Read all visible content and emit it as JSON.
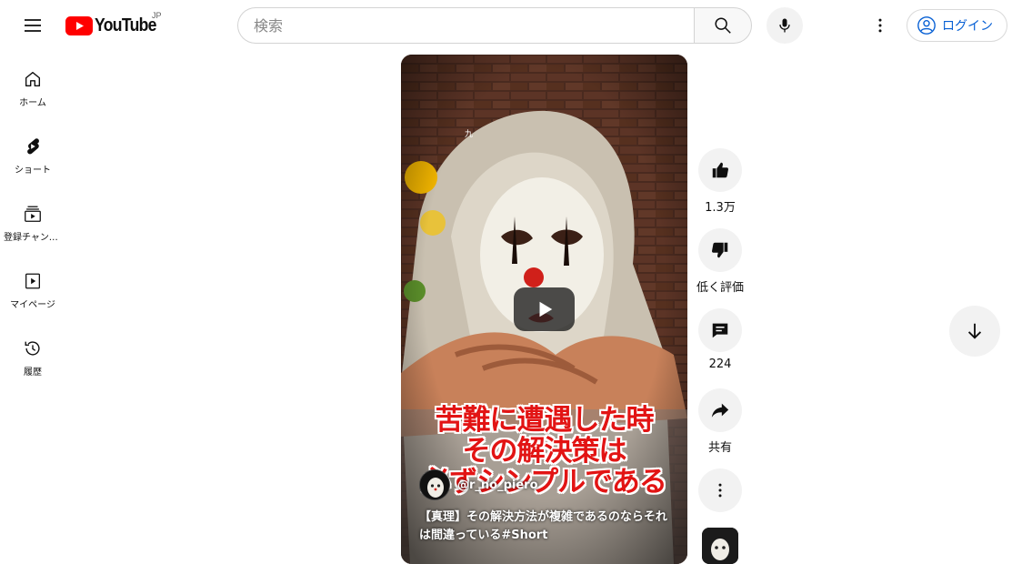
{
  "header": {
    "logo_text": "YouTube",
    "region": "JP",
    "search_placeholder": "検索",
    "login_label": "ログイン"
  },
  "sidebar": {
    "items": [
      {
        "label": "ホーム",
        "icon": "home-icon"
      },
      {
        "label": "ショート",
        "icon": "shorts-icon"
      },
      {
        "label": "登録チャンネル",
        "icon": "subscriptions-icon"
      },
      {
        "label": "マイページ",
        "icon": "library-icon"
      },
      {
        "label": "履歴",
        "icon": "history-icon"
      }
    ]
  },
  "video": {
    "caption_lines": [
      "苦難に遭遇した時",
      "その解決策は",
      "必ずシンプルである"
    ],
    "small_mark": "九",
    "channel_handle": "@r_no_piero",
    "title": "【真理】その解決方法が複雑であるのならそれは間違っている#Short"
  },
  "actions": {
    "like_count": "1.3万",
    "dislike_label": "低く評価",
    "comment_count": "224",
    "share_label": "共有"
  },
  "colors": {
    "brand_red": "#ff0000",
    "link_blue": "#065fd4",
    "caption_red": "#e21414",
    "button_bg": "#f2f2f2"
  }
}
